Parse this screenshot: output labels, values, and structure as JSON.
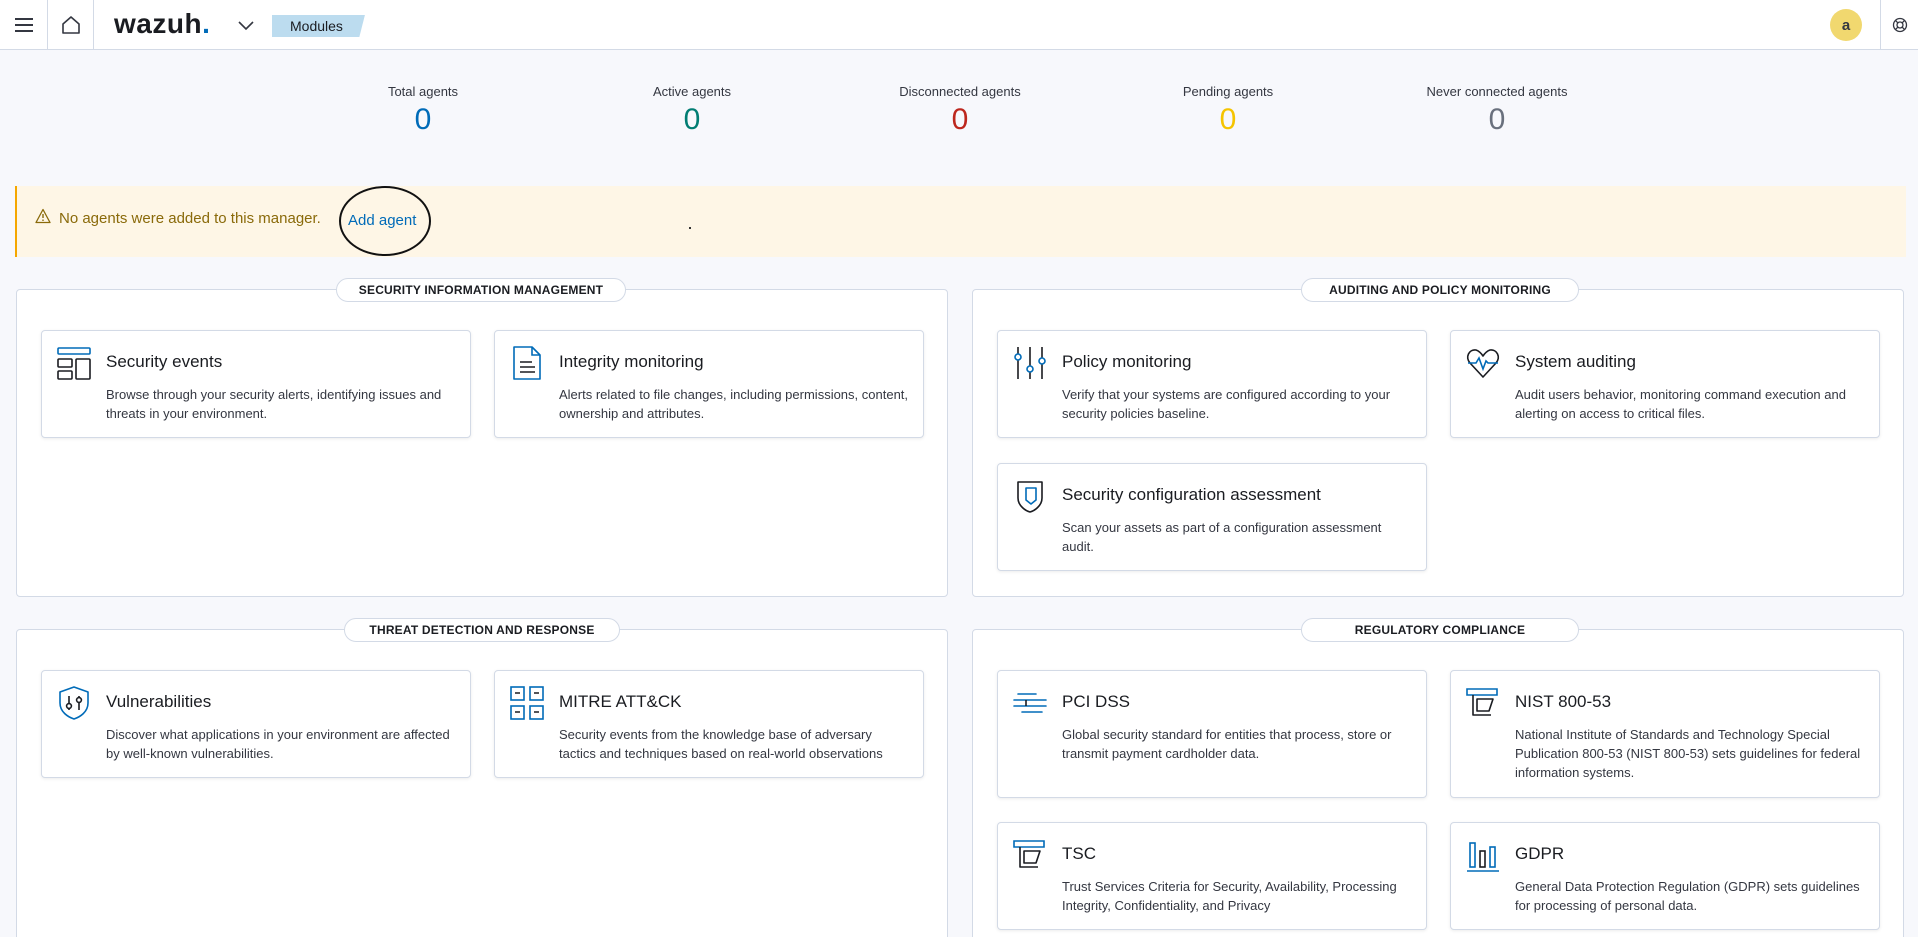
{
  "header": {
    "logo_text": "wazuh",
    "logo_dot": ".",
    "breadcrumb": "Modules",
    "avatar_initial": "a"
  },
  "stats": [
    {
      "label": "Total agents",
      "value": "0",
      "color": "#006bb8"
    },
    {
      "label": "Active agents",
      "value": "0",
      "color": "#017d73"
    },
    {
      "label": "Disconnected agents",
      "value": "0",
      "color": "#bd271e"
    },
    {
      "label": "Pending agents",
      "value": "0",
      "color": "#f5c400"
    },
    {
      "label": "Never connected agents",
      "value": "0",
      "color": "#69707d"
    }
  ],
  "callout": {
    "message": "No agents were added to this manager.",
    "link": "Add agent"
  },
  "panels": {
    "sim": "SECURITY INFORMATION MANAGEMENT",
    "apm": "AUDITING AND POLICY MONITORING",
    "tdr": "THREAT DETECTION AND RESPONSE",
    "rc": "REGULATORY COMPLIANCE"
  },
  "cards": {
    "security_events": {
      "title": "Security events",
      "desc": "Browse through your security alerts, identifying issues and threats in your environment."
    },
    "integrity_monitoring": {
      "title": "Integrity monitoring",
      "desc": "Alerts related to file changes, including permissions, content, ownership and attributes."
    },
    "policy_monitoring": {
      "title": "Policy monitoring",
      "desc": "Verify that your systems are configured according to your security policies baseline."
    },
    "system_auditing": {
      "title": "System auditing",
      "desc": "Audit users behavior, monitoring command execution and alerting on access to critical files."
    },
    "sca": {
      "title": "Security configuration assessment",
      "desc": "Scan your assets as part of a configuration assessment audit."
    },
    "vulnerabilities": {
      "title": "Vulnerabilities",
      "desc": "Discover what applications in your environment are affected by well-known vulnerabilities."
    },
    "mitre": {
      "title": "MITRE ATT&CK",
      "desc": "Security events from the knowledge base of adversary tactics and techniques based on real-world observations"
    },
    "pci": {
      "title": "PCI DSS",
      "desc": "Global security standard for entities that process, store or transmit payment cardholder data."
    },
    "nist": {
      "title": "NIST 800-53",
      "desc": "National Institute of Standards and Technology Special Publication 800-53 (NIST 800-53) sets guidelines for federal information systems."
    },
    "tsc": {
      "title": "TSC",
      "desc": "Trust Services Criteria for Security, Availability, Processing Integrity, Confidentiality, and Privacy"
    },
    "gdpr": {
      "title": "GDPR",
      "desc": "General Data Protection Regulation (GDPR) sets guidelines for processing of personal data."
    }
  },
  "colors": {
    "accent": "#006bb8",
    "icon": "#006bb8"
  }
}
